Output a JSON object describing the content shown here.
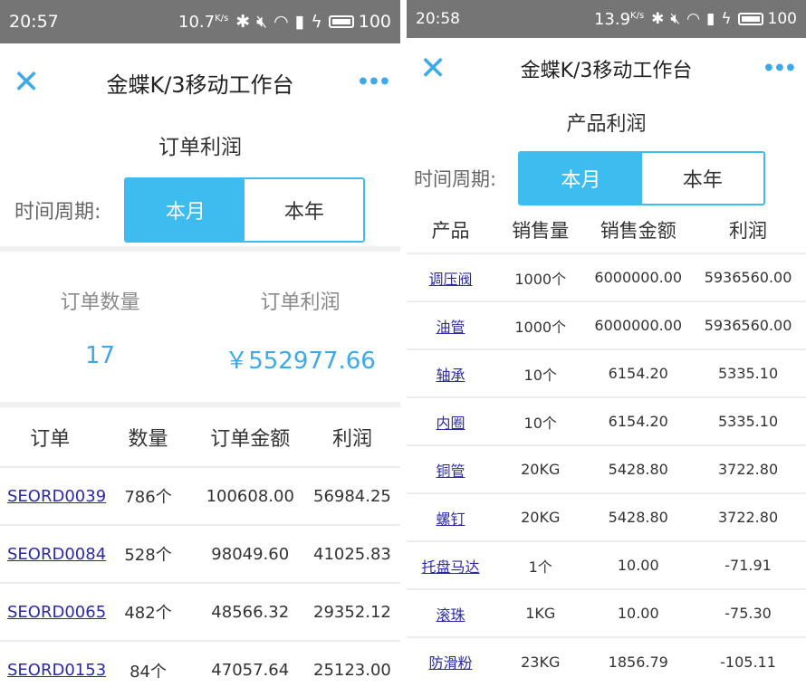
{
  "left": {
    "status": {
      "time": "20:57",
      "speed": "10.7",
      "speed_unit": "K/s",
      "battery": "100"
    },
    "nav": {
      "close": "X",
      "title": "金蝶K/3移动工作台",
      "more": "•••"
    },
    "section_title": "订单利润",
    "period": {
      "label": "时间周期:",
      "options": [
        "本月",
        "本年"
      ],
      "selected": "本月"
    },
    "summary": {
      "count_label": "订单数量",
      "count_value": "17",
      "profit_label": "订单利润",
      "profit_value": "￥552977.66"
    },
    "table": {
      "headers": [
        "订单",
        "数量",
        "订单金额",
        "利润"
      ],
      "rows": [
        [
          "SEORD0039",
          "786个",
          "100608.00",
          "56984.25"
        ],
        [
          "SEORD0084",
          "528个",
          "98049.60",
          "41025.83"
        ],
        [
          "SEORD0065",
          "482个",
          "48566.32",
          "29352.12"
        ],
        [
          "SEORD0153",
          "84个",
          "47057.64",
          "25123.00"
        ]
      ]
    }
  },
  "right": {
    "status": {
      "time": "20:58",
      "speed": "13.9",
      "speed_unit": "K/s",
      "battery": "100"
    },
    "nav": {
      "close": "X",
      "title": "金蝶K/3移动工作台",
      "more": "•••"
    },
    "section_title": "产品利润",
    "period": {
      "label": "时间周期:",
      "options": [
        "本月",
        "本年"
      ],
      "selected": "本月"
    },
    "table": {
      "headers": [
        "产品",
        "销售量",
        "销售金额",
        "利润"
      ],
      "rows": [
        [
          "调压阀",
          "1000个",
          "6000000.00",
          "5936560.00"
        ],
        [
          "油管",
          "1000个",
          "6000000.00",
          "5936560.00"
        ],
        [
          "轴承",
          "10个",
          "6154.20",
          "5335.10"
        ],
        [
          "内圈",
          "10个",
          "6154.20",
          "5335.10"
        ],
        [
          "铜管",
          "20KG",
          "5428.80",
          "3722.80"
        ],
        [
          "螺钉",
          "20KG",
          "5428.80",
          "3722.80"
        ],
        [
          "托盘马达",
          "1个",
          "10.00",
          "-71.91"
        ],
        [
          "滚珠",
          "1KG",
          "10.00",
          "-75.30"
        ],
        [
          "防滑粉",
          "23KG",
          "1856.79",
          "-105.11"
        ]
      ]
    }
  },
  "colors": {
    "accent": "#3dbcf0",
    "icon_blue": "#3da9e8",
    "link": "#2a2aa8",
    "statusbar": "#757575"
  },
  "icons": [
    "bluetooth-icon",
    "mute-icon",
    "wifi-icon",
    "signal-icon",
    "charging-icon",
    "battery-icon",
    "close-icon",
    "more-icon"
  ]
}
